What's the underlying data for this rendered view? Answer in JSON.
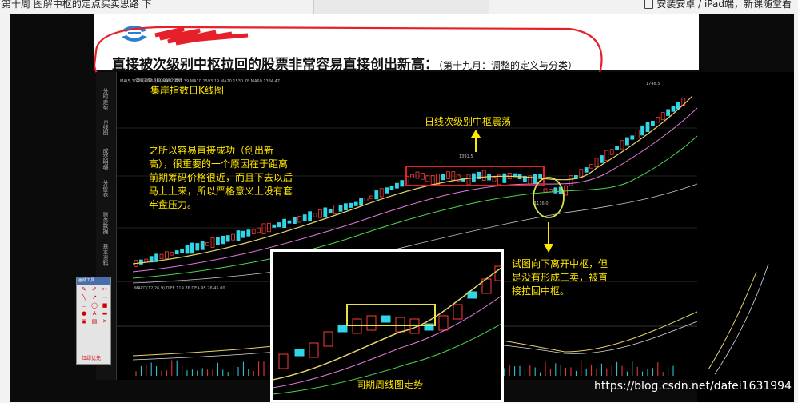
{
  "top_bar": {
    "left_text": "第十周 图解中枢的定点买卖思路 下",
    "right_text": "安装安卓 / iPad端，新课随堂看",
    "download_icon": "download-icon"
  },
  "slide": {
    "title": "直接被次级别中枢拉回的股票非常容易直接创出新高：",
    "subtitle": "（第十九月：调整的定义与分类）"
  },
  "chart": {
    "chart_title": "集岸指数日K线图",
    "info_line": "MA(5,10,20,40,60,0) MA5 1687.39 MA10 1593.19 MA20 1530.78 MA60 1384.47",
    "info_line_top": "集岸指数 DEX 0000 日线",
    "macd_line": "MACD(12,26,9) DIFF 119.76 DEA 95.26 45.00",
    "side_tabs": [
      "分时走势",
      "K线图",
      "成交明细",
      "分价表",
      "财务数据",
      "基本资料"
    ],
    "low_label": "1116.0",
    "peak_label": "1391.5",
    "high_label": "1748.5"
  },
  "annotations": {
    "left": "之所以容易直接成功（创出新高），很重要的一个原因在于距离前期筹码价格很近，而且下去以后马上上来，所以严格意义上没有套牢盘压力。",
    "top": "日线次级别中枢震荡",
    "right": "试图向下离开中枢，但是没有形成三卖，被直接拉回中枢。"
  },
  "inset": {
    "caption": "同期周线图走势"
  },
  "tool_panel": {
    "title": "画线工具",
    "footer": "红绿优先"
  },
  "watermark": "https://blog.csdn.net/dafei1631994",
  "colors": {
    "annotation": "#ffe600",
    "red_circle": "#e5202a",
    "up_candle": "#ff3b3b",
    "down_candle": "#2fd6e8",
    "zhongshu_box": "#e5202a"
  }
}
